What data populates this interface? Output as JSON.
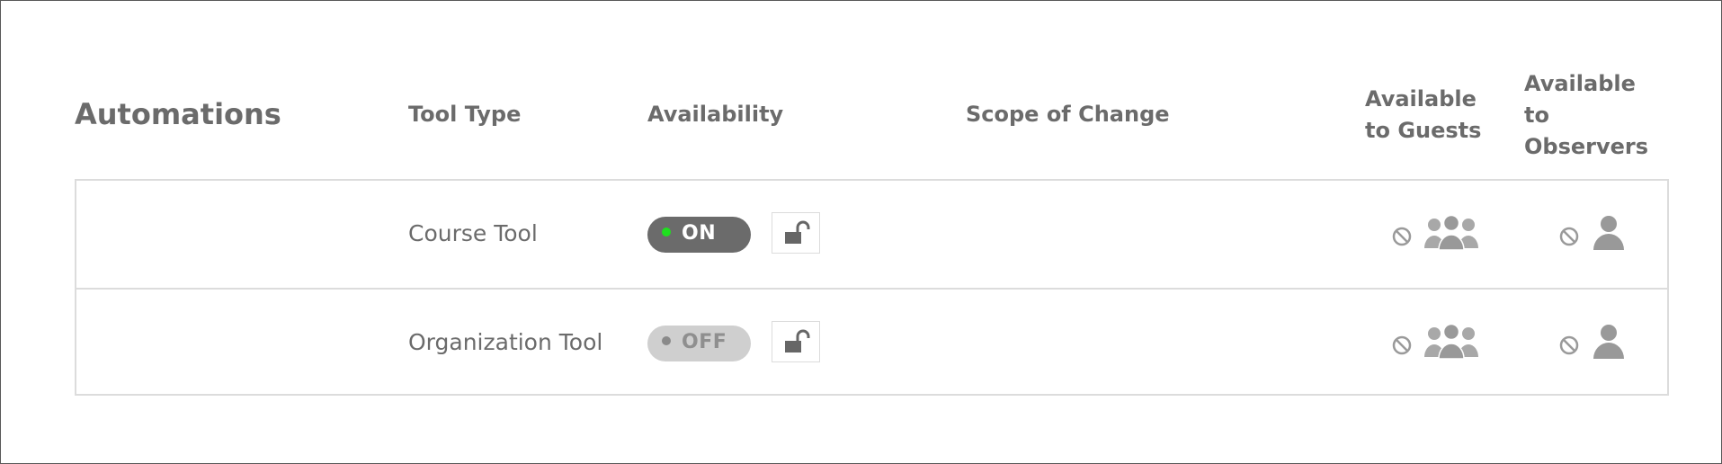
{
  "section": {
    "title": "Automations"
  },
  "columns": {
    "tool_type": "Tool Type",
    "availability": "Availability",
    "scope": "Scope of Change",
    "guests": "Available\nto Guests",
    "observers": "Available\nto\nObservers"
  },
  "rows": [
    {
      "tool_type": "Course Tool",
      "toggle_label": "ON",
      "toggle_state": "on",
      "lock_icon": "unlock-icon",
      "guests_icon": "no-guests-icon",
      "observers_icon": "no-observers-icon"
    },
    {
      "tool_type": "Organization Tool",
      "toggle_label": "OFF",
      "toggle_state": "off",
      "lock_icon": "unlock-icon",
      "guests_icon": "no-guests-icon",
      "observers_icon": "no-observers-icon"
    }
  ],
  "colors": {
    "text": "#6b6b6b",
    "toggle_on_bg": "#6b6b6b",
    "toggle_on_dot": "#1fe01f",
    "toggle_off_bg": "#cfcfcf",
    "border": "#dcdcdc",
    "icon": "#9a9a9a"
  }
}
